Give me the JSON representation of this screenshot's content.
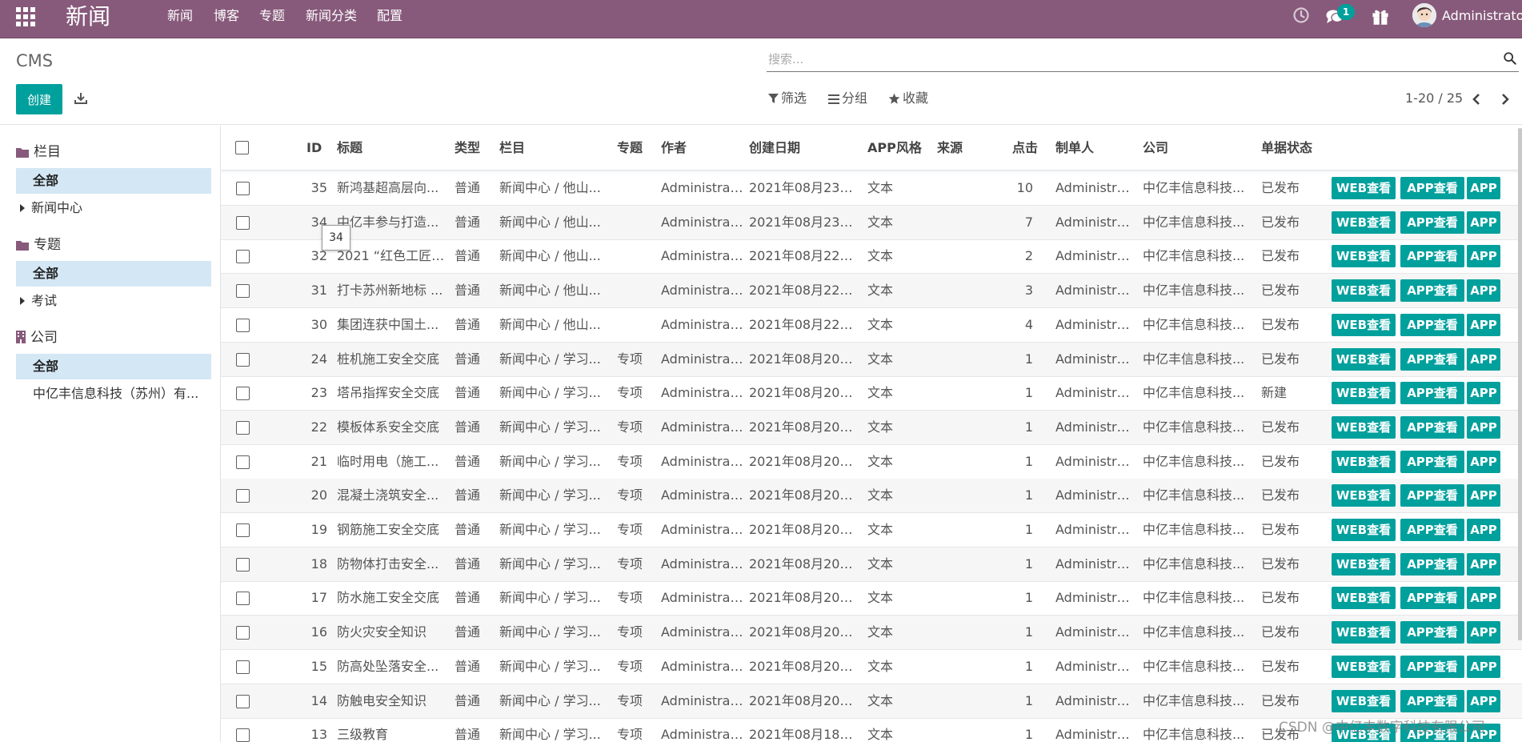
{
  "navbar": {
    "brand": "新闻",
    "menu": [
      "新闻",
      "博客",
      "专题",
      "新闻分类",
      "配置"
    ],
    "message_count": "1",
    "user_name": "Administrator",
    "accent_color": "#875a7b"
  },
  "control_panel": {
    "breadcrumb": "CMS",
    "search_placeholder": "搜索...",
    "create_label": "创建",
    "filters_label": "筛选",
    "group_label": "分组",
    "favorites_label": "收藏",
    "pager_value": "1-20 / 25",
    "primary_color": "#00a09d"
  },
  "side_panel": {
    "sections": [
      {
        "title": "栏目",
        "icon": "folder-icon",
        "all_label": "全部",
        "items": [
          "新闻中心"
        ]
      },
      {
        "title": "专题",
        "icon": "folder-icon",
        "all_label": "全部",
        "items": [
          "考试"
        ]
      },
      {
        "title": "公司",
        "icon": "building-icon",
        "all_label": "全部",
        "items": [
          "中亿丰信息科技（苏州）有..."
        ]
      }
    ]
  },
  "list": {
    "columns": [
      "ID",
      "标题",
      "类型",
      "栏目",
      "专题",
      "作者",
      "创建日期",
      "APP风格",
      "来源",
      "点击",
      "制单人",
      "公司",
      "单据状态"
    ],
    "action_labels": [
      "WEB查看",
      "APP查看",
      "APP"
    ],
    "rows": [
      {
        "id": "35",
        "title": "新鸿基超高层向...",
        "type": "普通",
        "category": "新闻中心 / 他山...",
        "topic": "",
        "author": "Administrator",
        "date": "2021年08月23日 ...",
        "style": "文本",
        "source": "",
        "clicks": "10",
        "creator": "Administrator",
        "company": "中亿丰信息科技...",
        "state": "已发布"
      },
      {
        "id": "34",
        "title": "中亿丰参与打造...",
        "type": "普通",
        "category": "新闻中心 / 他山...",
        "topic": "",
        "author": "Administrator",
        "date": "2021年08月23日 ...",
        "style": "文本",
        "source": "",
        "clicks": "7",
        "creator": "Administrator",
        "company": "中亿丰信息科技...",
        "state": "已发布"
      },
      {
        "id": "32",
        "title": "2021 “红色工匠”...",
        "type": "普通",
        "category": "新闻中心 / 他山...",
        "topic": "",
        "author": "Administrator",
        "date": "2021年08月22日 ...",
        "style": "文本",
        "source": "",
        "clicks": "2",
        "creator": "Administrator",
        "company": "中亿丰信息科技...",
        "state": "已发布"
      },
      {
        "id": "31",
        "title": "打卡苏州新地标 ...",
        "type": "普通",
        "category": "新闻中心 / 他山...",
        "topic": "",
        "author": "Administrator",
        "date": "2021年08月22日 ...",
        "style": "文本",
        "source": "",
        "clicks": "3",
        "creator": "Administrator",
        "company": "中亿丰信息科技...",
        "state": "已发布"
      },
      {
        "id": "30",
        "title": "集团连获中国土...",
        "type": "普通",
        "category": "新闻中心 / 他山...",
        "topic": "",
        "author": "Administrator",
        "date": "2021年08月22日 ...",
        "style": "文本",
        "source": "",
        "clicks": "4",
        "creator": "Administrator",
        "company": "中亿丰信息科技...",
        "state": "已发布"
      },
      {
        "id": "24",
        "title": "桩机施工安全交底",
        "type": "普通",
        "category": "新闻中心 / 学习...",
        "topic": "专项",
        "author": "Administrator",
        "date": "2021年08月20日 ...",
        "style": "文本",
        "source": "",
        "clicks": "1",
        "creator": "Administrator",
        "company": "中亿丰信息科技...",
        "state": "已发布"
      },
      {
        "id": "23",
        "title": "塔吊指挥安全交底",
        "type": "普通",
        "category": "新闻中心 / 学习...",
        "topic": "专项",
        "author": "Administrator",
        "date": "2021年08月20日 ...",
        "style": "文本",
        "source": "",
        "clicks": "1",
        "creator": "Administrat...",
        "company": "中亿丰信息科技...",
        "state": "新建"
      },
      {
        "id": "22",
        "title": "模板体系安全交底",
        "type": "普通",
        "category": "新闻中心 / 学习...",
        "topic": "专项",
        "author": "Administrator",
        "date": "2021年08月20日 ...",
        "style": "文本",
        "source": "",
        "clicks": "1",
        "creator": "Administrator",
        "company": "中亿丰信息科技...",
        "state": "已发布"
      },
      {
        "id": "21",
        "title": "临时用电（施工...",
        "type": "普通",
        "category": "新闻中心 / 学习...",
        "topic": "专项",
        "author": "Administrator",
        "date": "2021年08月20日 ...",
        "style": "文本",
        "source": "",
        "clicks": "1",
        "creator": "Administrator",
        "company": "中亿丰信息科技...",
        "state": "已发布"
      },
      {
        "id": "20",
        "title": "混凝土浇筑安全...",
        "type": "普通",
        "category": "新闻中心 / 学习...",
        "topic": "专项",
        "author": "Administrator",
        "date": "2021年08月20日 ...",
        "style": "文本",
        "source": "",
        "clicks": "1",
        "creator": "Administrator",
        "company": "中亿丰信息科技...",
        "state": "已发布"
      },
      {
        "id": "19",
        "title": "钢筋施工安全交底",
        "type": "普通",
        "category": "新闻中心 / 学习...",
        "topic": "专项",
        "author": "Administrator",
        "date": "2021年08月20日 ...",
        "style": "文本",
        "source": "",
        "clicks": "1",
        "creator": "Administrator",
        "company": "中亿丰信息科技...",
        "state": "已发布"
      },
      {
        "id": "18",
        "title": "防物体打击安全...",
        "type": "普通",
        "category": "新闻中心 / 学习...",
        "topic": "专项",
        "author": "Administrator",
        "date": "2021年08月20日 ...",
        "style": "文本",
        "source": "",
        "clicks": "1",
        "creator": "Administrator",
        "company": "中亿丰信息科技...",
        "state": "已发布"
      },
      {
        "id": "17",
        "title": "防水施工安全交底",
        "type": "普通",
        "category": "新闻中心 / 学习...",
        "topic": "专项",
        "author": "Administrator",
        "date": "2021年08月20日 ...",
        "style": "文本",
        "source": "",
        "clicks": "1",
        "creator": "Administrator",
        "company": "中亿丰信息科技...",
        "state": "已发布"
      },
      {
        "id": "16",
        "title": "防火灾安全知识",
        "type": "普通",
        "category": "新闻中心 / 学习...",
        "topic": "专项",
        "author": "Administrator",
        "date": "2021年08月20日 ...",
        "style": "文本",
        "source": "",
        "clicks": "1",
        "creator": "Administrator",
        "company": "中亿丰信息科技...",
        "state": "已发布"
      },
      {
        "id": "15",
        "title": "防高处坠落安全...",
        "type": "普通",
        "category": "新闻中心 / 学习...",
        "topic": "专项",
        "author": "Administrator",
        "date": "2021年08月20日 ...",
        "style": "文本",
        "source": "",
        "clicks": "1",
        "creator": "Administrator",
        "company": "中亿丰信息科技...",
        "state": "已发布"
      },
      {
        "id": "14",
        "title": "防触电安全知识",
        "type": "普通",
        "category": "新闻中心 / 学习...",
        "topic": "专项",
        "author": "Administrator",
        "date": "2021年08月20日 ...",
        "style": "文本",
        "source": "",
        "clicks": "1",
        "creator": "Administrator",
        "company": "中亿丰信息科技...",
        "state": "已发布"
      },
      {
        "id": "13",
        "title": "三级教育",
        "type": "普通",
        "category": "新闻中心 / 学习...",
        "topic": "专项",
        "author": "Administrator",
        "date": "2021年08月18日 ...",
        "style": "文本",
        "source": "",
        "clicks": "1",
        "creator": "Administrator",
        "company": "中亿丰信息科技...",
        "state": "已发布"
      }
    ]
  },
  "tooltip": "34",
  "watermark": "CSDN @中亿丰数字科技有限公司"
}
